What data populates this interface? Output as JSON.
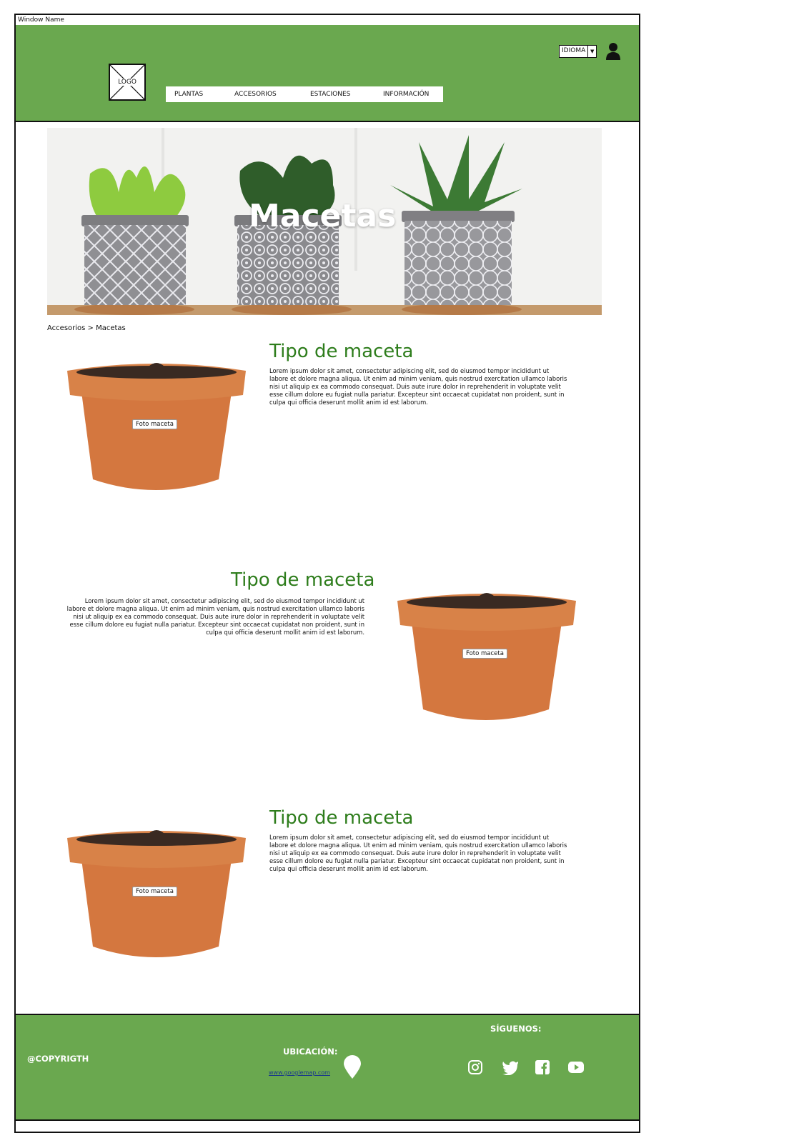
{
  "window": {
    "title": "Window Name"
  },
  "header": {
    "logo_text": "LOGO",
    "nav": [
      "PLANTAS",
      "ACCESORIOS",
      "ESTACIONES",
      "INFORMACIÓN"
    ],
    "language": "IDIOMA",
    "colors": {
      "header_bg": "#6aa84f"
    }
  },
  "hero": {
    "title": "Macetas"
  },
  "breadcrumb": "Accesorios > Macetas",
  "products": [
    {
      "title": "Tipo de maceta",
      "text": "Lorem ipsum dolor sit amet, consectetur adipiscing elit, sed do eiusmod tempor incididunt ut labore et dolore magna aliqua. Ut enim ad minim veniam, quis nostrud exercitation ullamco laboris nisi ut aliquip ex ea commodo consequat. Duis aute irure dolor in reprehenderit in voluptate velit esse cillum dolore eu fugiat nulla pariatur. Excepteur sint occaecat cupidatat non proident, sunt in culpa qui officia deserunt mollit anim id est laborum.",
      "image_label": "Foto maceta"
    },
    {
      "title": "Tipo de maceta",
      "text": "Lorem ipsum dolor sit amet, consectetur adipiscing elit, sed do eiusmod tempor incididunt ut labore et dolore magna aliqua. Ut enim ad minim veniam, quis nostrud exercitation ullamco laboris nisi ut aliquip ex ea commodo consequat. Duis aute irure dolor in reprehenderit in voluptate velit esse cillum dolore eu fugiat nulla pariatur. Excepteur sint occaecat cupidatat non proident, sunt in culpa qui officia deserunt mollit anim id est laborum.",
      "image_label": "Foto maceta"
    },
    {
      "title": "Tipo de maceta",
      "text": "Lorem ipsum dolor sit amet, consectetur adipiscing elit, sed do eiusmod tempor incididunt ut labore et dolore magna aliqua. Ut enim ad minim veniam, quis nostrud exercitation ullamco laboris nisi ut aliquip ex ea commodo consequat. Duis aute irure dolor in reprehenderit in voluptate velit esse cillum dolore eu fugiat nulla pariatur. Excepteur sint occaecat cupidatat non proident, sunt in culpa qui officia deserunt mollit anim id est laborum.",
      "image_label": "Foto maceta"
    }
  ],
  "footer": {
    "copyright": "@COPYRIGTH",
    "location_label": "UBICACIÓN:",
    "location_link": "www.googlemap.com",
    "follow_label": "SÍGUENOS:",
    "social_icons": [
      "instagram-icon",
      "twitter-icon",
      "facebook-icon",
      "youtube-icon"
    ]
  }
}
